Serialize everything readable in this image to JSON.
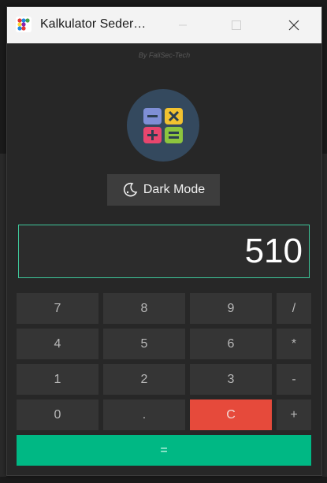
{
  "window": {
    "title": "Kalkulator Seder…",
    "credit": "By FaliSec-Tech"
  },
  "controls": {
    "minimize_icon": "minimize-icon",
    "maximize_icon": "maximize-icon",
    "close_icon": "close-icon"
  },
  "mode_button": {
    "label": "Dark Mode",
    "icon": "moon-icon"
  },
  "display": {
    "value": "510"
  },
  "keys": [
    "7",
    "8",
    "9",
    "/",
    "4",
    "5",
    "6",
    "*",
    "1",
    "2",
    "3",
    "-",
    "0",
    ".",
    "C",
    "+"
  ],
  "equals_label": "=",
  "colors": {
    "accent": "#00b884",
    "clear": "#e64a3b",
    "display_border": "#3ec79a"
  }
}
